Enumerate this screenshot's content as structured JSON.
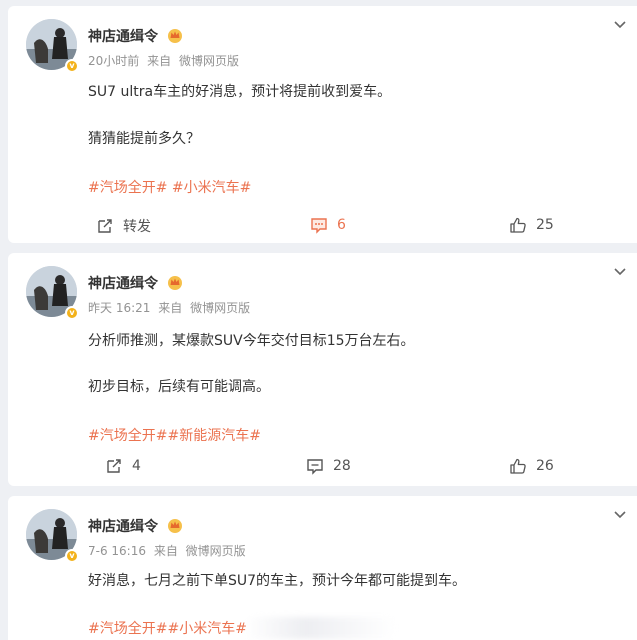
{
  "posts": [
    {
      "username": "神店通缉令",
      "time": "20小时前",
      "source_prefix": "来自",
      "source": "微博网页版",
      "lines": [
        "SU7 ultra车主的好消息，预计将提前收到爱车。",
        "猜猜能提前多久？"
      ],
      "tags": "#汽场全开# #小米汽车#",
      "repost_label": "转发",
      "comment_count": "6",
      "like_count": "25"
    },
    {
      "username": "神店通缉令",
      "time": "昨天 16:21",
      "source_prefix": "来自",
      "source": "微博网页版",
      "lines": [
        "分析师推测，某爆款SUV今年交付目标15万台左右。",
        "初步目标，后续有可能调高。"
      ],
      "tags": "#汽场全开##新能源汽车#",
      "repost_label": "4",
      "comment_count": "28",
      "like_count": "26"
    },
    {
      "username": "神店通缉令",
      "time": "7-6 16:16",
      "source_prefix": "来自",
      "source": "微博网页版",
      "lines": [
        "好消息，七月之前下单SU7的车主，预计今年都可能提到车。"
      ],
      "tags": "#汽场全开##小米汽车#"
    }
  ],
  "colors": {
    "accent": "#eb7350",
    "meta": "#939393",
    "background": "#eef0f4",
    "vip_badge": "#f3b21b"
  },
  "icons": {
    "repost": "repost-icon",
    "comment": "comment-icon",
    "like": "like-icon",
    "more": "chevron-down-icon",
    "vip": "crown-icon",
    "verified": "verified-badge-icon"
  }
}
